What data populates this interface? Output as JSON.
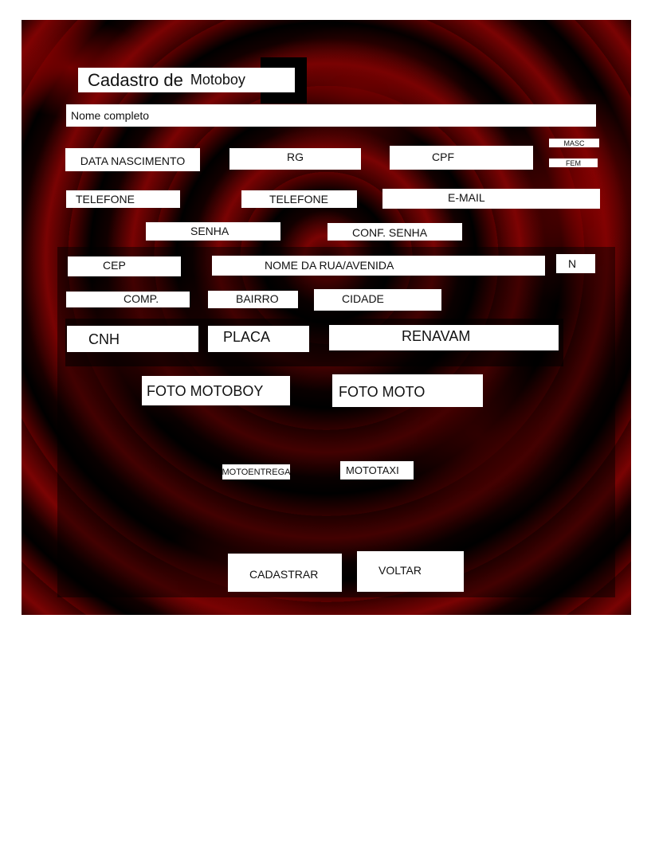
{
  "form": {
    "title_part1": "Cadastro de",
    "title_part2": "Motoboy",
    "nome_completo": "Nome completo",
    "gender": {
      "masc": "MASC",
      "fem": "FEM"
    },
    "data_nascimento": "DATA NASCIMENTO",
    "rg": "RG",
    "cpf": "CPF",
    "telefone_1": "TELEFONE",
    "telefone_2": "TELEFONE",
    "email": "E-MAIL",
    "senha": "SENHA",
    "conf_senha": "CONF. SENHA",
    "cep": "CEP",
    "rua": "NOME DA RUA/AVENIDA",
    "numero": "N",
    "complemento": "COMP.",
    "bairro": "BAIRRO",
    "cidade": "CIDADE",
    "cnh": "CNH",
    "placa": "PLACA",
    "renavam": "RENAVAM",
    "foto_motoboy": "FOTO MOTOBOY",
    "foto_moto": "FOTO MOTO",
    "motoentrega": "MOTOENTREGA",
    "mototaxi": "MOTOTAXI",
    "cadastrar": "CADASTRAR",
    "voltar": "VOLTAR"
  },
  "colors": {
    "background": "#200000",
    "accent": "#7a0303",
    "field": "#ffffff"
  }
}
